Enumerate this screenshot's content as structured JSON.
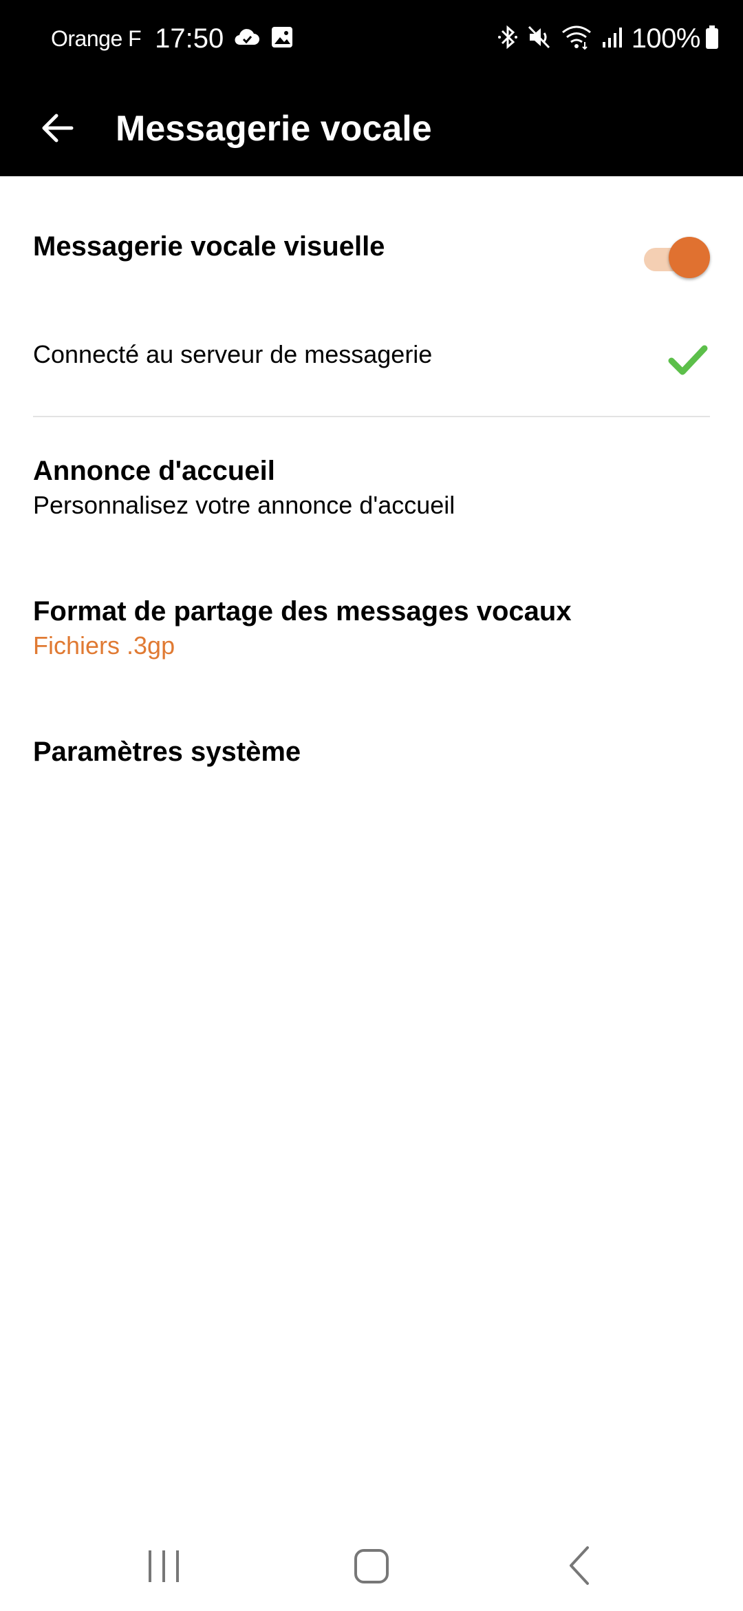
{
  "status_bar": {
    "carrier": "Orange F",
    "time": "17:50",
    "battery": "100%"
  },
  "app_bar": {
    "title": "Messagerie vocale"
  },
  "settings": {
    "visual_voicemail": {
      "title": "Messagerie vocale visuelle",
      "enabled": true
    },
    "server_status": {
      "text": "Connecté au serveur de messagerie"
    },
    "greeting": {
      "title": "Annonce d'accueil",
      "subtitle": "Personnalisez votre annonce d'accueil"
    },
    "share_format": {
      "title": "Format de partage des messages vocaux",
      "value": "Fichiers .3gp"
    },
    "system_settings": {
      "title": "Paramètres système"
    }
  },
  "colors": {
    "accent": "#e07a33",
    "check": "#5cbf4a",
    "header_bg": "#000000"
  }
}
